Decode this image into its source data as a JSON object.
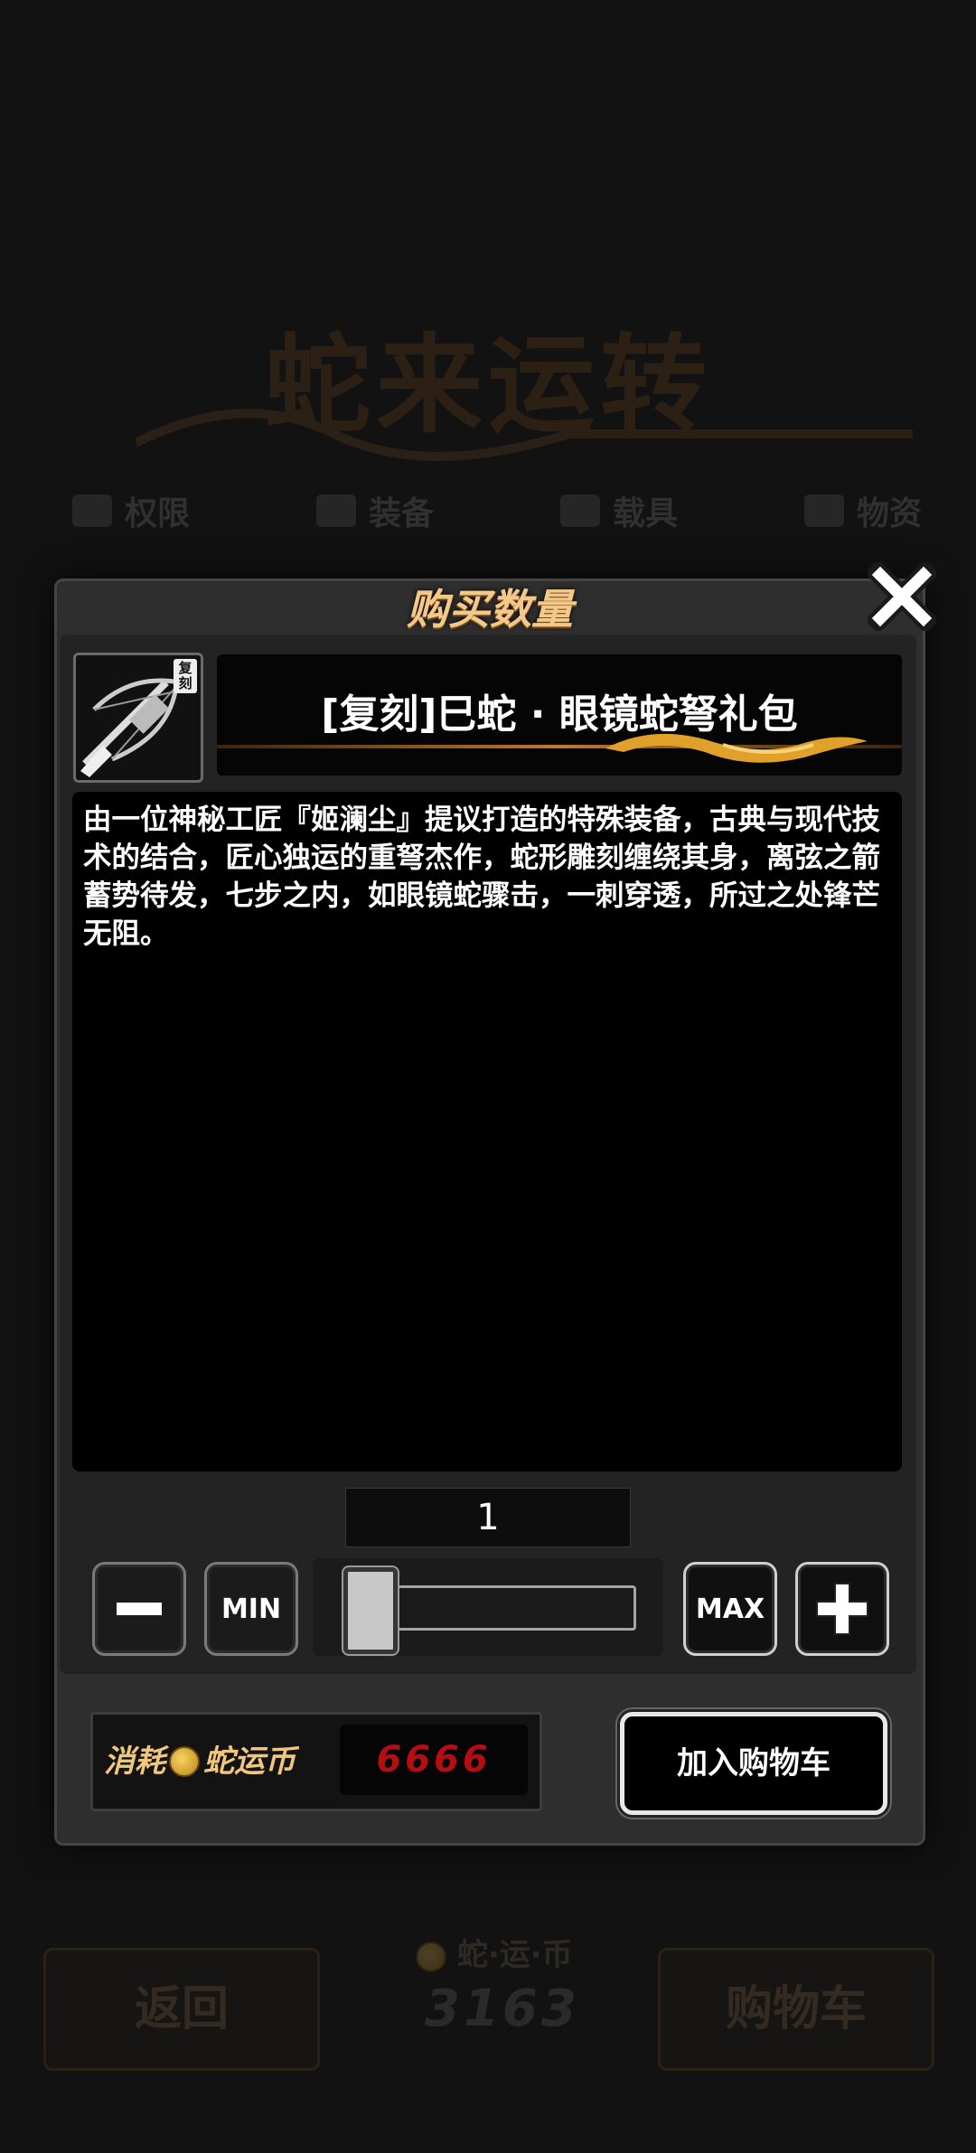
{
  "background": {
    "title": "蛇来运转",
    "tabs": [
      {
        "label": "权限",
        "icon": "box-icon"
      },
      {
        "label": "装备",
        "icon": "shield-icon"
      },
      {
        "label": "载具",
        "icon": "car-icon"
      },
      {
        "label": "物资",
        "icon": "crate-icon"
      }
    ],
    "back_label": "返回",
    "currency_label": "蛇·运·币",
    "currency_balance": "3163",
    "cart_label": "购物车"
  },
  "modal": {
    "title": "购买数量",
    "close_icon": "close-icon",
    "item": {
      "tag": "复刻",
      "name": "[复刻]巳蛇 · 眼镜蛇弩礼包",
      "icon": "crossbow-icon",
      "description": "由一位神秘工匠『姬澜尘』提议打造的特殊装备，古典与现代技术的结合，匠心独运的重弩杰作，蛇形雕刻缠绕其身，离弦之箭蓄势待发，七步之内，如眼镜蛇骤击，一刺穿透，所过之处锋芒无阻。"
    },
    "quantity": "1",
    "quantity_slider_fraction": 0.0,
    "min_label": "MIN",
    "max_label": "MAX",
    "minus_icon": "minus-icon",
    "plus_icon": "plus-icon",
    "cost_prefix": "消耗",
    "cost_currency": "蛇运币",
    "cost_value": "6666",
    "add_to_cart_label": "加入购物车"
  },
  "colors": {
    "title_gold": "#f3c98b",
    "cost_red": "#b50d12",
    "panel": "#2e2e2e"
  }
}
